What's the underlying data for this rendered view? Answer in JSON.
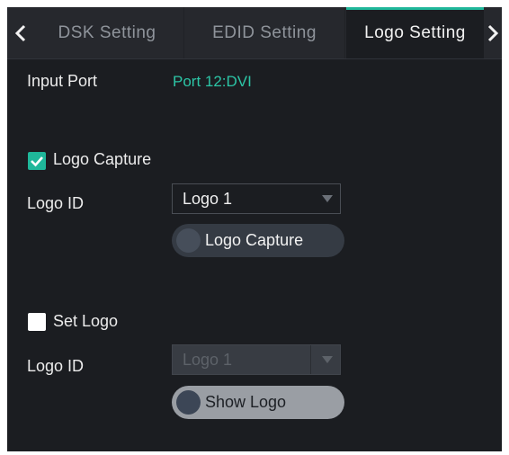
{
  "tabs": {
    "prev_icon": "chevron-left-icon",
    "next_icon": "chevron-right-icon",
    "items": [
      {
        "label": "DSK Setting"
      },
      {
        "label": "EDID Setting"
      },
      {
        "label": "Logo Setting"
      }
    ],
    "active": "Logo Setting"
  },
  "input_port": {
    "label": "Input Port",
    "value": "Port 12:DVI"
  },
  "logo_capture": {
    "checkbox_label": "Logo Capture",
    "checked": true,
    "id_label": "Logo ID",
    "select_value": "Logo 1",
    "button_label": "Logo Capture"
  },
  "set_logo": {
    "checkbox_label": "Set Logo",
    "checked": false,
    "id_label": "Logo ID",
    "select_value": "Logo 1",
    "select_disabled": true,
    "button_label": "Show Logo"
  },
  "colors": {
    "accent": "#1fb79a",
    "background": "#1b1d21",
    "tab_bar": "#26282d"
  }
}
